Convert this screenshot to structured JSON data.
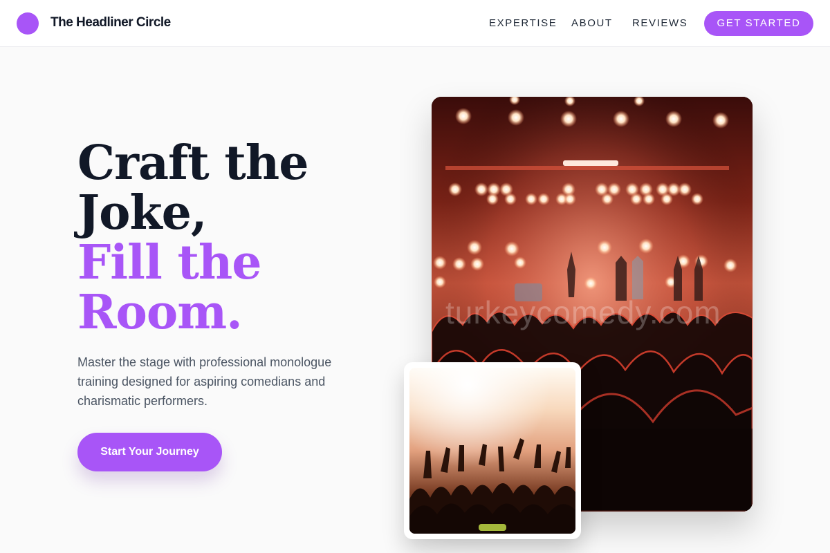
{
  "header": {
    "brand_name": "The Headliner Circle",
    "nav": {
      "expertise": "EXPERTISE",
      "about": "ABOUT",
      "reviews": "REVIEWS"
    },
    "cta_label": "GET STARTED"
  },
  "hero": {
    "headline_dark": [
      "Craft the",
      "Joke,"
    ],
    "headline_accent": [
      "Fill the",
      "Room."
    ],
    "subtext": "Master the stage with professional monologue training designed for aspiring comedians and charismatic performers.",
    "cta_label": "Start Your Journey"
  },
  "media": {
    "main_photo_watermark": "turkeycomedy.com"
  },
  "colors": {
    "accent": "#a855f7",
    "heading": "#111827",
    "body_text": "#4b5563",
    "background": "#fafafa"
  }
}
